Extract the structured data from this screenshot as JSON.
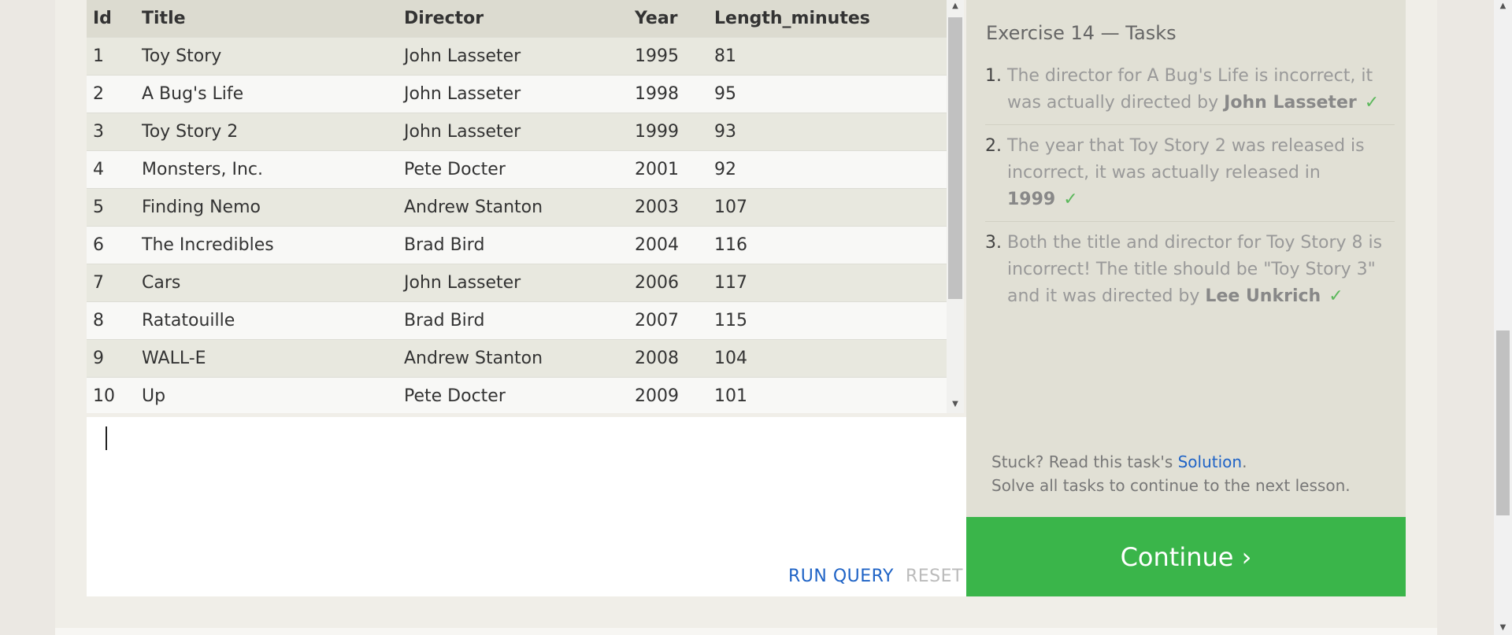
{
  "table": {
    "columns": [
      "Id",
      "Title",
      "Director",
      "Year",
      "Length_minutes"
    ],
    "rows": [
      [
        "1",
        "Toy Story",
        "John Lasseter",
        "1995",
        "81"
      ],
      [
        "2",
        "A Bug's Life",
        "John Lasseter",
        "1998",
        "95"
      ],
      [
        "3",
        "Toy Story 2",
        "John Lasseter",
        "1999",
        "93"
      ],
      [
        "4",
        "Monsters, Inc.",
        "Pete Docter",
        "2001",
        "92"
      ],
      [
        "5",
        "Finding Nemo",
        "Andrew Stanton",
        "2003",
        "107"
      ],
      [
        "6",
        "The Incredibles",
        "Brad Bird",
        "2004",
        "116"
      ],
      [
        "7",
        "Cars",
        "John Lasseter",
        "2006",
        "117"
      ],
      [
        "8",
        "Ratatouille",
        "Brad Bird",
        "2007",
        "115"
      ],
      [
        "9",
        "WALL-E",
        "Andrew Stanton",
        "2008",
        "104"
      ],
      [
        "10",
        "Up",
        "Pete Docter",
        "2009",
        "101"
      ]
    ]
  },
  "editor": {
    "run_label": "RUN QUERY",
    "reset_label": "RESET"
  },
  "tasks": {
    "title": "Exercise 14 — Tasks",
    "items": [
      {
        "num": "1.",
        "text": "The director for A Bug's Life is incorrect, it was actually directed by ",
        "bold": "John Lasseter",
        "after": "",
        "check": "✓"
      },
      {
        "num": "2.",
        "text": "The year that Toy Story 2 was released is incorrect, it was actually released in ",
        "bold": "1999",
        "after": "",
        "check": "✓"
      },
      {
        "num": "3.",
        "text": "Both the title and director for Toy Story 8 is incorrect! The title should be \"Toy Story 3\" and it was directed by ",
        "bold": "Lee Unkrich",
        "after": "",
        "check": "✓"
      }
    ],
    "stuck_prefix": "Stuck? Read this task's ",
    "solution_link": "Solution",
    "stuck_suffix": ".",
    "solve_note": "Solve all tasks to continue to the next lesson.",
    "continue_label": "Continue ›"
  },
  "colors": {
    "accent_green": "#3ab54a",
    "link_blue": "#1f63c6",
    "check_green": "#5cb85c"
  }
}
